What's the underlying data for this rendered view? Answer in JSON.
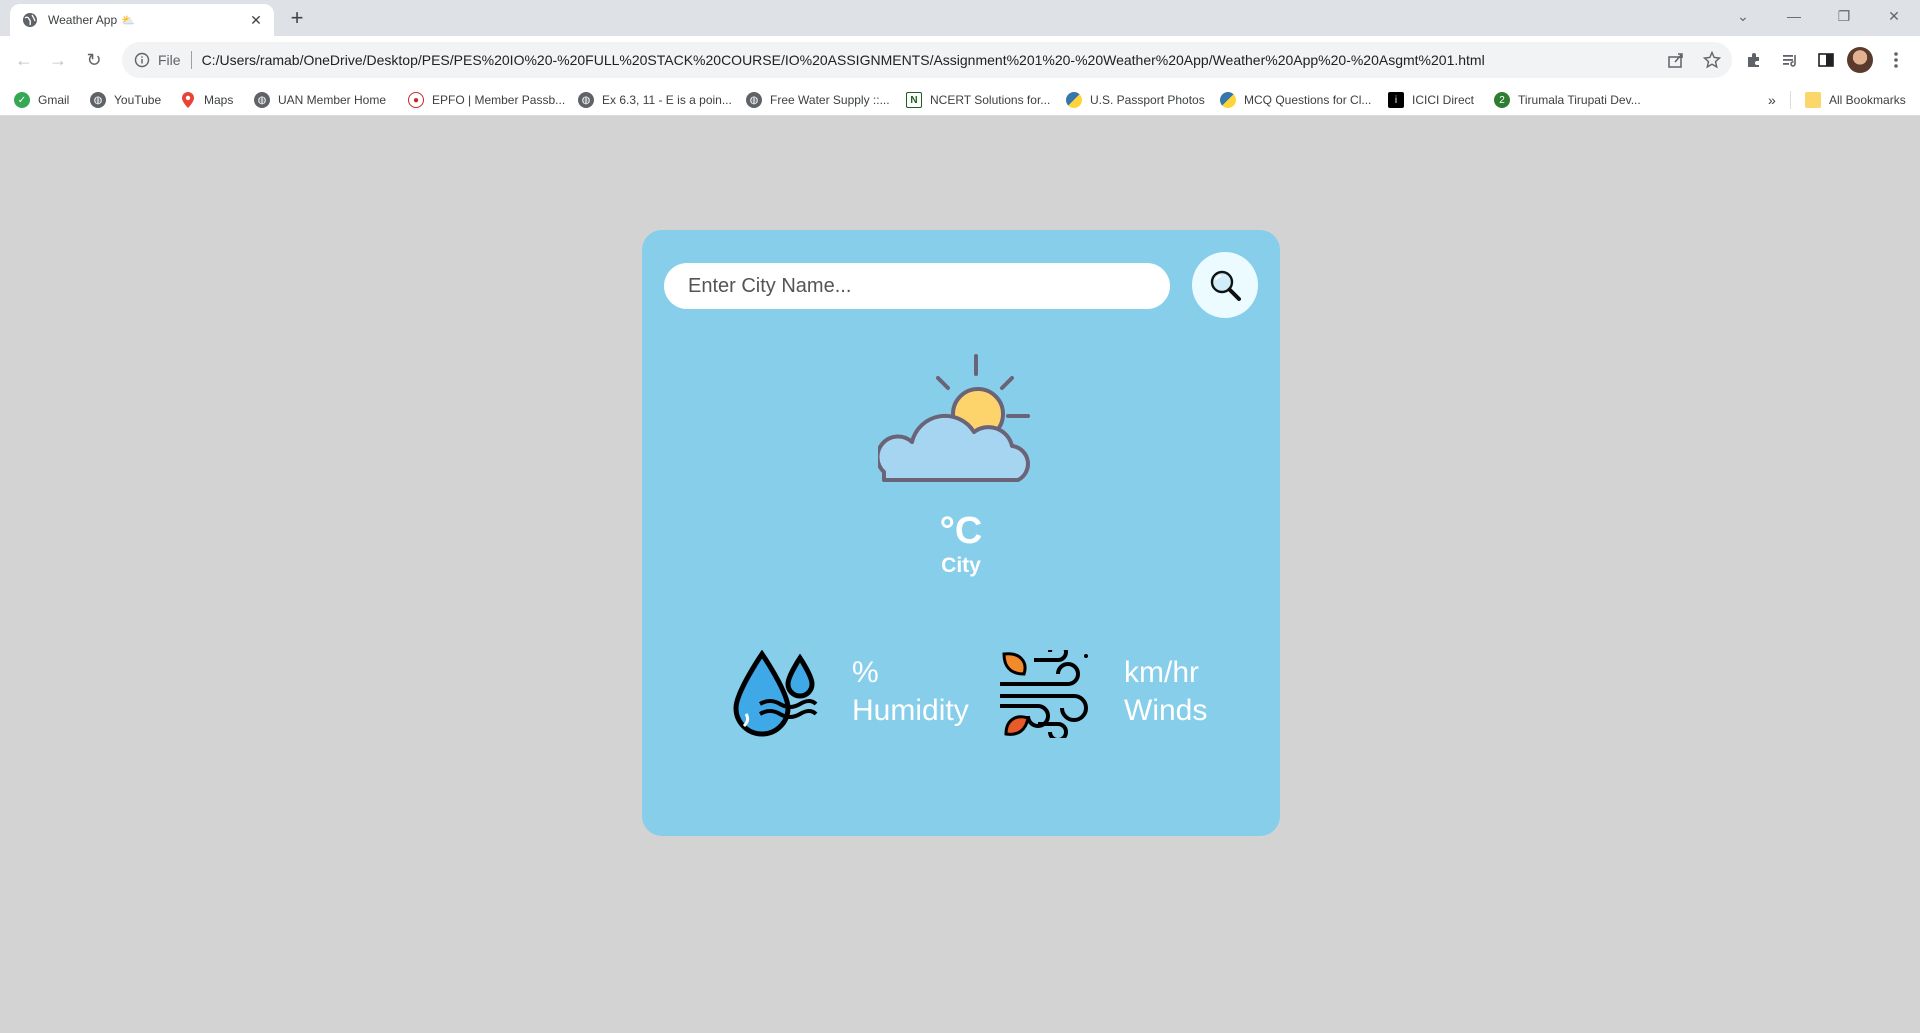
{
  "browser": {
    "tab_title": "Weather App",
    "tab_emoji": "⛅",
    "url_scheme": "File",
    "url": "C:/Users/ramab/OneDrive/Desktop/PES/PES%20IO%20-%20FULL%20STACK%20COURSE/IO%20ASSIGNMENTS/Assignment%201%20-%20Weather%20App/Weather%20App%20-%20Asgmt%201.html"
  },
  "bookmarks": {
    "items": [
      {
        "label": "Gmail",
        "icon": "gmail-icon",
        "color": "#34a853"
      },
      {
        "label": "YouTube",
        "icon": "globe-icon",
        "color": "#5f6368"
      },
      {
        "label": "Maps",
        "icon": "maps-icon",
        "color": "#ea4335"
      },
      {
        "label": "UAN Member Home",
        "icon": "globe-icon",
        "color": "#5f6368"
      },
      {
        "label": "EPFO | Member Passb...",
        "icon": "epfo-icon",
        "color": "#c62828"
      },
      {
        "label": "Ex 6.3, 11 - E is a poin...",
        "icon": "globe-icon",
        "color": "#5f6368"
      },
      {
        "label": "Free Water Supply ::...",
        "icon": "globe-icon",
        "color": "#5f6368"
      },
      {
        "label": "NCERT Solutions for...",
        "icon": "ncert-icon",
        "color": "#1b5e20"
      },
      {
        "label": "U.S. Passport Photos",
        "icon": "python-icon",
        "color": "#3776ab"
      },
      {
        "label": "MCQ Questions for Cl...",
        "icon": "python-icon",
        "color": "#3776ab"
      },
      {
        "label": "ICICI Direct",
        "icon": "icici-icon",
        "color": "#000000"
      },
      {
        "label": "Tirumala Tirupati Dev...",
        "icon": "ttd-icon",
        "color": "#2e7d32"
      }
    ],
    "overflow": "»",
    "all_bookmarks": "All Bookmarks"
  },
  "app": {
    "search_placeholder": "Enter City Name...",
    "temperature": "°C",
    "city": "City",
    "humidity_value": "%",
    "humidity_label": "Humidity",
    "wind_value": "km/hr",
    "wind_label": "Winds",
    "colors": {
      "page_bg": "#d3d3d3",
      "card_bg": "#87ceeb",
      "search_btn_bg": "#ebfbff"
    }
  }
}
